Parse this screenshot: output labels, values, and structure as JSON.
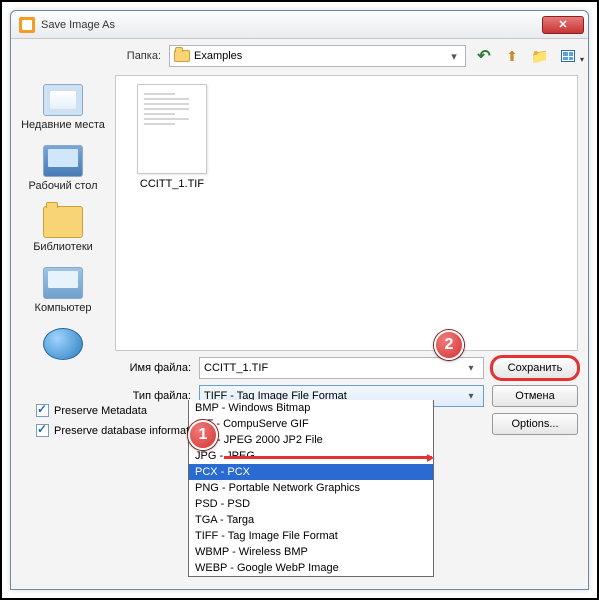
{
  "window": {
    "title": "Save Image As"
  },
  "toprow": {
    "label": "Папка:",
    "folder": "Examples"
  },
  "sidebar": {
    "items": [
      {
        "label": "Недавние места"
      },
      {
        "label": "Рабочий стол"
      },
      {
        "label": "Библиотеки"
      },
      {
        "label": "Компьютер"
      },
      {
        "label": ""
      }
    ]
  },
  "filepane": {
    "thumb_name": "CCITT_1.TIF"
  },
  "form": {
    "filename_label": "Имя файла:",
    "filename_value": "CCITT_1.TIF",
    "filetype_label": "Тип файла:",
    "filetype_value": "TIFF - Tag Image File Format"
  },
  "buttons": {
    "save": "Сохранить",
    "cancel": "Отмена",
    "options": "Options..."
  },
  "dropdown": {
    "options": [
      "BMP - Windows Bitmap",
      "GIF - CompuServe GIF",
      "JP2 - JPEG 2000 JP2 File",
      "JPG - JPEG",
      "PCX - PCX",
      "PNG - Portable Network Graphics",
      "PSD - PSD",
      "TGA - Targa",
      "TIFF - Tag Image File Format",
      "WBMP - Wireless BMP",
      "WEBP - Google WebP Image"
    ],
    "selected_index": 4
  },
  "checks": {
    "meta": "Preserve Metadata",
    "db": "Preserve database information"
  },
  "callouts": {
    "one": "1",
    "two": "2"
  }
}
